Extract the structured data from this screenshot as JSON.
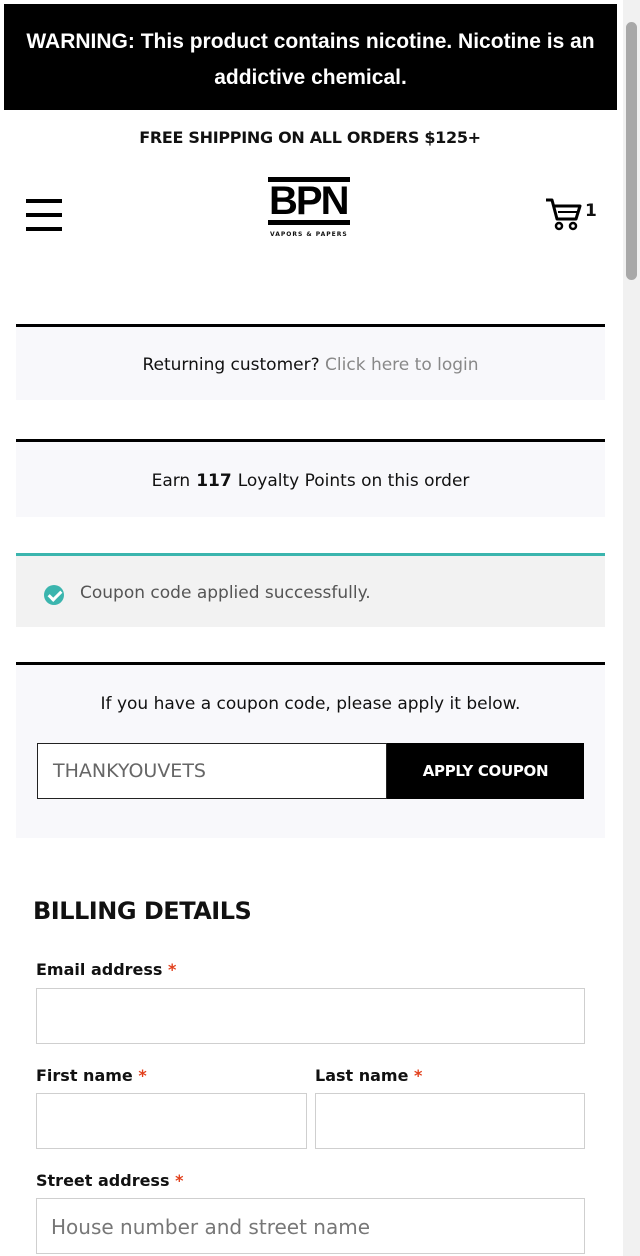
{
  "warning_banner": {
    "line1": "WARNING: This product contains nicotine. Nicotine is an",
    "line2": "addictive chemical."
  },
  "promo_bar": {
    "text": "FREE SHIPPING ON ALL ORDERS $125+"
  },
  "header": {
    "logo_text": "BPN",
    "logo_tagline": "VAPORS & PAPERS",
    "cart_count": "1"
  },
  "login_notice": {
    "prompt": "Returning customer?",
    "link": "Click here to login"
  },
  "loyalty_notice": {
    "prefix": "Earn",
    "points": "117",
    "suffix": "Loyalty Points on this order"
  },
  "coupon_success": {
    "message": "Coupon code applied successfully."
  },
  "coupon_form": {
    "intro": "If you have a coupon code, please apply it below.",
    "input_value": "THANKYOUVETS",
    "button_label": "APPLY COUPON"
  },
  "billing": {
    "title": "BILLING DETAILS",
    "required_mark": "*",
    "email_label": "Email address",
    "first_name_label": "First name",
    "last_name_label": "Last name",
    "street_label": "Street address",
    "street_placeholder": "House number and street name"
  },
  "colors": {
    "accent": "#3bb5ae",
    "required": "#e2401c",
    "notice_bg": "#f8f8fb"
  }
}
